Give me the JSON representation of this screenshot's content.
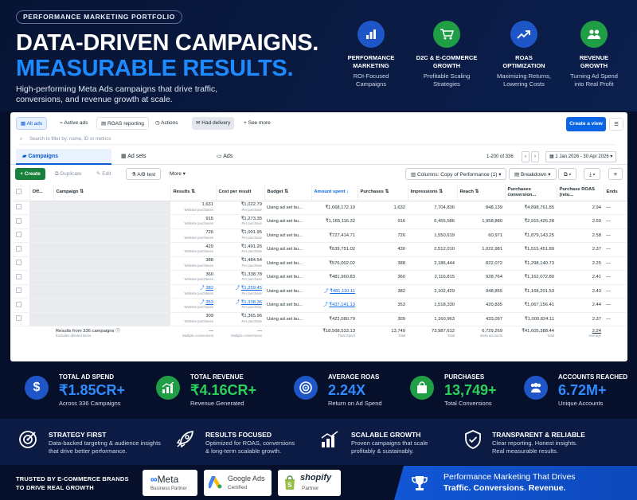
{
  "header": {
    "pill": "PERFORMANCE MARKETING PORTFOLIO",
    "headline_1": "DATA-DRIVEN CAMPAIGNS.",
    "headline_2": "MEASURABLE RESULTS.",
    "subtitle": "High-performing Meta Ads campaigns that drive traffic, conversions, and revenue growth at scale.",
    "features": [
      {
        "icon": "bar-chart-icon",
        "title_1": "PERFORMANCE",
        "title_2": "MARKETING",
        "desc_1": "ROI-Focused",
        "desc_2": "Campaigns",
        "color": "#1e55c7"
      },
      {
        "icon": "shopping-cart-icon",
        "title_1": "D2C & E-COMMERCE",
        "title_2": "GROWTH",
        "desc_1": "Profitable Scaling",
        "desc_2": "Strategies",
        "color": "#1f9e45"
      },
      {
        "icon": "trend-up-icon",
        "title_1": "ROAS",
        "title_2": "OPTIMIZATION",
        "desc_1": "Maximizing Returns,",
        "desc_2": "Lowering Costs",
        "color": "#1e55c7"
      },
      {
        "icon": "users-icon",
        "title_1": "REVENUE",
        "title_2": "GROWTH",
        "desc_1": "Turning Ad Spend",
        "desc_2": "into Real Profit",
        "color": "#1f9e45"
      }
    ]
  },
  "ads_manager": {
    "toolbar": {
      "all_ads": "All ads",
      "active_ads": "Active ads",
      "roas_reporting": "ROAS reporting",
      "actions": "Actions",
      "had_delivery": "Had delivery",
      "see_more": "See more",
      "create_view": "Create a view"
    },
    "filter_placeholder": "Search to filter by: name, ID or metrics",
    "tabs": {
      "campaigns": "Campaigns",
      "ad_sets": "Ad sets",
      "ads": "Ads"
    },
    "range": "1-200 of 336",
    "date_range": "1 Jan 2026 - 30 Apr 2026",
    "actions": {
      "create": "Create",
      "duplicate": "Duplicate",
      "edit": "Edit",
      "ab_test": "A/B test",
      "more": "More",
      "columns": "Columns: Copy of Performance (1)",
      "breakdown": "Breakdown"
    },
    "columns": [
      "Off...",
      "Campaign",
      "Results",
      "Cost per result",
      "Budget",
      "Amount spent",
      "Purchases",
      "Impressions",
      "Reach",
      "Purchases conversion...",
      "Purchase ROAS (retu...",
      "Ends"
    ],
    "rows": [
      {
        "results": "1,631",
        "rlabel": "Website purchases",
        "cost": "₹1,022.79",
        "clabel": "Per purchase",
        "budget": "Using ad set bu...",
        "spent": "₹1,668,172.10",
        "purchases": "1,632",
        "impressions": "7,704,836",
        "reach": "848,139",
        "conv": "₹4,898,761.85",
        "roas": "2.94",
        "link": false
      },
      {
        "results": "915",
        "rlabel": "Website purchases",
        "cost": "₹1,273.35",
        "clabel": "Per purchase",
        "budget": "Using ad set bu...",
        "spent": "₹1,165,116.32",
        "purchases": "916",
        "impressions": "6,455,586",
        "reach": "1,958,880",
        "conv": "₹2,915,426.28",
        "roas": "2.50",
        "link": false
      },
      {
        "results": "726",
        "rlabel": "Website purchases",
        "cost": "₹1,001.95",
        "clabel": "Per purchase",
        "budget": "Using ad set bu...",
        "spent": "₹727,414.71",
        "purchases": "726",
        "impressions": "1,550,619",
        "reach": "60,971",
        "conv": "₹1,879,143.25",
        "roas": "2.58",
        "link": false
      },
      {
        "results": "429",
        "rlabel": "Website purchases",
        "cost": "₹1,491.26",
        "clabel": "Per purchase",
        "budget": "Using ad set bu...",
        "spent": "₹639,751.02",
        "purchases": "430",
        "impressions": "2,512,010",
        "reach": "1,022,981",
        "conv": "₹1,515,451.89",
        "roas": "2.37",
        "link": false
      },
      {
        "results": "388",
        "rlabel": "Website purchases",
        "cost": "₹1,484.54",
        "clabel": "Per purchase",
        "budget": "Using ad set bu...",
        "spent": "₹576,002.02",
        "purchases": "388",
        "impressions": "2,186,444",
        "reach": "822,072",
        "conv": "₹1,298,140.73",
        "roas": "2.25",
        "link": false
      },
      {
        "results": "360",
        "rlabel": "Website purchases",
        "cost": "₹1,338.78",
        "clabel": "Per purchase",
        "budget": "Using ad set bu...",
        "spent": "₹481,960.83",
        "purchases": "360",
        "impressions": "2,116,815",
        "reach": "928,764",
        "conv": "₹1,162,072.80",
        "roas": "2.41",
        "link": false
      },
      {
        "results": "382",
        "rlabel": "Website purchases",
        "cost": "₹1,259.45",
        "clabel": "Per purchase",
        "budget": "Using ad set bu...",
        "spent": "₹481,110.11",
        "purchases": "382",
        "impressions": "2,102,429",
        "reach": "948,855",
        "conv": "₹1,168,201.53",
        "roas": "2.43",
        "link": true
      },
      {
        "results": "353",
        "rlabel": "Website purchases",
        "cost": "₹1,338.36",
        "clabel": "Per purchase",
        "budget": "Using ad set bu...",
        "spent": "₹437,141.13",
        "purchases": "353",
        "impressions": "1,518,330",
        "reach": "420,835",
        "conv": "₹1,067,156.41",
        "roas": "2.44",
        "link": true
      },
      {
        "results": "309",
        "rlabel": "Website purchases",
        "cost": "₹1,365.96",
        "clabel": "Per purchase",
        "budget": "Using ad set bu...",
        "spent": "₹422,080.79",
        "purchases": "309",
        "impressions": "1,160,963",
        "reach": "433,097",
        "conv": "₹1,000,824.11",
        "roas": "2.37",
        "link": false
      }
    ],
    "totals": {
      "label": "Results from 336 campaigns",
      "sublabel": "Excludes deleted items",
      "results": "—",
      "rsub": "Multiple conversions",
      "cost": "—",
      "csub": "Multiple conversions",
      "spent": "₹18,568,533.13",
      "ssub": "Total Spent",
      "purchases": "13,749",
      "psub": "Total",
      "impressions": "73,987,612",
      "isub": "Total",
      "reach": "6,729,269",
      "resub": "Meta accounts",
      "conv": "₹41,605,388.44",
      "cvsub": "Total",
      "roas": "2.24",
      "rosub": "Average"
    }
  },
  "stats": [
    {
      "label": "TOTAL AD SPEND",
      "value": "₹1.85CR+",
      "desc": "Across 336 Campaigns",
      "color": "#1e55c7",
      "vcolor": "#2f8cff",
      "icon": "dollar-icon"
    },
    {
      "label": "TOTAL REVENUE",
      "value": "₹4.16CR+",
      "desc": "Revenue Generated",
      "color": "#1f9e45",
      "vcolor": "#2bd15a",
      "icon": "growth-chart-icon"
    },
    {
      "label": "AVERAGE ROAS",
      "value": "2.24X",
      "desc": "Return on Ad Spend",
      "color": "#1e55c7",
      "vcolor": "#2f8cff",
      "icon": "target-icon"
    },
    {
      "label": "PURCHASES",
      "value": "13,749+",
      "desc": "Total Conversions",
      "color": "#1f9e45",
      "vcolor": "#2bd15a",
      "icon": "shopping-bag-icon"
    },
    {
      "label": "ACCOUNTS REACHED",
      "value": "6.72M+",
      "desc": "Unique Accounts",
      "color": "#1e55c7",
      "vcolor": "#2f8cff",
      "icon": "people-icon"
    }
  ],
  "pillars": [
    {
      "title": "STRATEGY FIRST",
      "d1": "Data-backed targeting & audience insights",
      "d2": "that drive better performance.",
      "icon": "crosshair-icon"
    },
    {
      "title": "RESULTS FOCUSED",
      "d1": "Optimized for ROAS, conversions",
      "d2": "& long-term scalable growth.",
      "icon": "rocket-icon"
    },
    {
      "title": "SCALABLE GROWTH",
      "d1": "Proven campaigns that scale",
      "d2": "profitably & sustainably.",
      "icon": "bar-growth-icon"
    },
    {
      "title": "TRANSPARENT & RELIABLE",
      "d1": "Clear reporting. Honest insights.",
      "d2": "Real measurable results.",
      "icon": "shield-check-icon"
    }
  ],
  "footer": {
    "trust_1": "TRUSTED BY E-COMMERCE BRANDS",
    "trust_2": "TO DRIVE REAL GROWTH",
    "meta_name": "Meta",
    "meta_sub": "Business Partner",
    "google_name": "Google Ads",
    "google_sub": "Certified",
    "shopify_name": "shopify",
    "shopify_sub": "Partner",
    "banner_1": "Performance Marketing That Drives",
    "banner_2": "Traffic. Conversions. Revenue."
  }
}
